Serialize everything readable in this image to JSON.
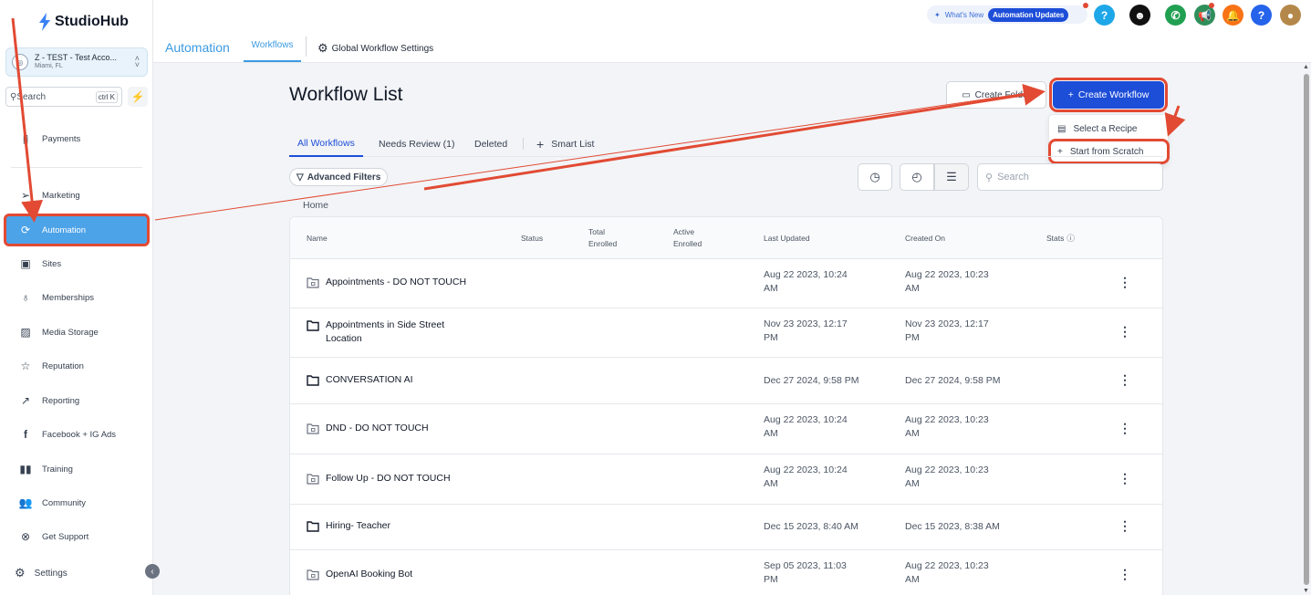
{
  "app": {
    "logo": "StudioHub"
  },
  "account": {
    "name": "Z - TEST - Test Acco...",
    "location": "Miami, FL"
  },
  "sidebar": {
    "search_placeholder": "Search",
    "search_shortcut": "ctrl K",
    "items": [
      {
        "label": "Payments",
        "icon": "payments-icon"
      },
      {
        "label": "Marketing",
        "icon": "send-icon"
      },
      {
        "label": "Automation",
        "icon": "automation-icon"
      },
      {
        "label": "Sites",
        "icon": "sites-icon"
      },
      {
        "label": "Memberships",
        "icon": "award-icon"
      },
      {
        "label": "Media Storage",
        "icon": "image-icon"
      },
      {
        "label": "Reputation",
        "icon": "star-icon"
      },
      {
        "label": "Reporting",
        "icon": "trend-icon"
      },
      {
        "label": "Facebook + IG Ads",
        "icon": "facebook-icon"
      },
      {
        "label": "Training",
        "icon": "book-icon"
      },
      {
        "label": "Community",
        "icon": "users-icon"
      },
      {
        "label": "Get Support",
        "icon": "support-icon"
      }
    ],
    "settings": "Settings"
  },
  "topbar": {
    "whats_new": "What's New",
    "updates_pill": "Automation Updates"
  },
  "subnav": {
    "title": "Automation",
    "tab": "Workflows",
    "global_settings": "Global Workflow Settings"
  },
  "main": {
    "title": "Workflow List",
    "create_folder": "Create Folder",
    "create_workflow": "Create Workflow",
    "dropdown": [
      "Select a Recipe",
      "Start from Scratch"
    ],
    "tabs": [
      "All Workflows",
      "Needs Review (1)",
      "Deleted",
      "Smart List"
    ],
    "advanced_filters": "Advanced Filters",
    "search_placeholder": "Search",
    "breadcrumb": "Home"
  },
  "table": {
    "headers": {
      "name": "Name",
      "status": "Status",
      "total_1": "Total",
      "total_2": "Enrolled",
      "active_1": "Active",
      "active_2": "Enrolled",
      "last_updated": "Last Updated",
      "created_on": "Created On",
      "stats": "Stats"
    },
    "rows": [
      {
        "name": "Appointments - DO NOT TOUCH",
        "name2": "",
        "locked": true,
        "updated1": "Aug 22 2023, 10:24",
        "updated2": "AM",
        "created1": "Aug 22 2023, 10:23",
        "created2": "AM"
      },
      {
        "name": "Appointments in Side Street",
        "name2": "Location",
        "locked": false,
        "updated1": "Nov 23 2023, 12:17",
        "updated2": "PM",
        "created1": "Nov 23 2023, 12:17",
        "created2": "PM"
      },
      {
        "name": "CONVERSATION AI",
        "name2": "",
        "locked": false,
        "updated1": "Dec 27 2024, 9:58 PM",
        "updated2": "",
        "created1": "Dec 27 2024, 9:58 PM",
        "created2": ""
      },
      {
        "name": "DND - DO NOT TOUCH",
        "name2": "",
        "locked": true,
        "updated1": "Aug 22 2023, 10:24",
        "updated2": "AM",
        "created1": "Aug 22 2023, 10:23",
        "created2": "AM"
      },
      {
        "name": "Follow Up - DO NOT TOUCH",
        "name2": "",
        "locked": true,
        "updated1": "Aug 22 2023, 10:24",
        "updated2": "AM",
        "created1": "Aug 22 2023, 10:23",
        "created2": "AM"
      },
      {
        "name": "Hiring- Teacher",
        "name2": "",
        "locked": false,
        "updated1": "Dec 15 2023, 8:40 AM",
        "updated2": "",
        "created1": "Dec 15 2023, 8:38 AM",
        "created2": ""
      },
      {
        "name": "OpenAI Booking Bot",
        "name2": "",
        "locked": true,
        "updated1": "Sep 05 2023, 11:03",
        "updated2": "PM",
        "created1": "Aug 22 2023, 10:23",
        "created2": "AM"
      }
    ]
  },
  "colors": {
    "accent": "#1d4ed8",
    "sidebar_active": "#4da3e8",
    "annotation": "#e24a33"
  }
}
